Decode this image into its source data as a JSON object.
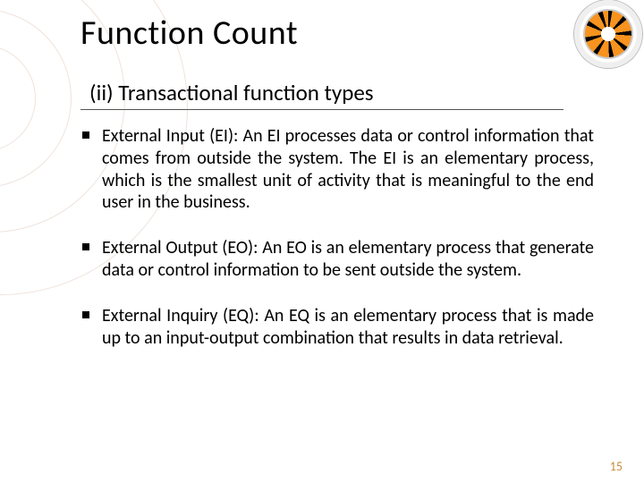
{
  "title": "Function Count",
  "subtitle": "(ii) Transactional function types",
  "bullets": [
    "External Input (EI): An EI processes data or control information that comes from outside the system. The EI is an elementary process, which is the smallest unit of activity that is meaningful to the end user in the business.",
    "External Output (EO): An EO is an elementary process that generate data or control information to be sent outside the system.",
    "External Inquiry (EQ): An EQ is an elementary process that is made up to an input-output combination that results in data retrieval."
  ],
  "page_number": "15"
}
